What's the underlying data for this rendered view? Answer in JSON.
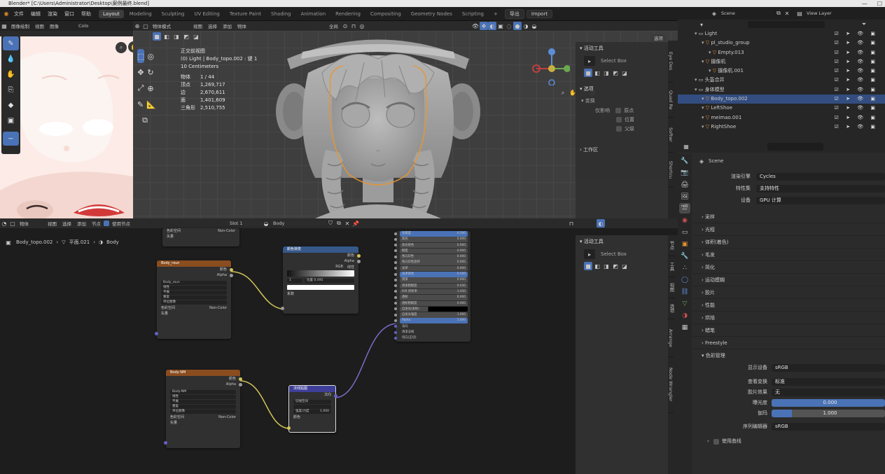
{
  "window": {
    "title": "Blender* [C:\\Users\\Administrator\\Desktop\\案例最终.blend]"
  },
  "menu": [
    "文件",
    "编辑",
    "渲染",
    "窗口",
    "帮助"
  ],
  "workspaces": [
    "Layout",
    "Modeling",
    "Sculpting",
    "UV Editing",
    "Texture Paint",
    "Shading",
    "Animation",
    "Rendering",
    "Compositing",
    "Geometry Nodes",
    "Scripting"
  ],
  "active_workspace": "Layout",
  "topbar_right": {
    "export": "导出",
    "import": "Import",
    "scene": "Scene",
    "view_layer": "View Layer"
  },
  "image_editor": {
    "mode": "图像绘制",
    "view": "视图",
    "image": "图像",
    "color": "Colo"
  },
  "viewport": {
    "mode": "物体模式",
    "menus": [
      "视图",
      "选择",
      "添加",
      "物体"
    ],
    "transform": "全局",
    "options": "选项",
    "info_title": "正交前视图",
    "info_object": "(0) Light | Body_topo.002 : 键 1",
    "info_scale": "10 Centimeters",
    "stats": [
      {
        "label": "物体",
        "value": "1 / 44"
      },
      {
        "label": "顶点",
        "value": "1,269,717"
      },
      {
        "label": "边",
        "value": "2,670,611"
      },
      {
        "label": "面",
        "value": "1,401,609"
      },
      {
        "label": "三角形",
        "value": "2,510,755"
      }
    ],
    "npanel": {
      "active_tool": "活动工具",
      "select_box": "Select Box",
      "options": "选项",
      "transform": "变换",
      "affect_only": "仅影响",
      "origin": "原点",
      "location": "位置",
      "parent": "父级",
      "workspace": "工作区"
    },
    "side_tabs": [
      "Eye Des",
      "Quad Re",
      "Softwr",
      "Shortcu"
    ]
  },
  "node_editor": {
    "menus": [
      "物体",
      "视图",
      "选择",
      "添加",
      "节点"
    ],
    "use_nodes": "使用节点",
    "slot": "Slot 1",
    "material": "Body",
    "breadcrumb": [
      "Body_topo.002",
      "平面.021",
      "Body"
    ],
    "npanel_active_tool": "活动工具",
    "npanel_select_box": "Select Box",
    "side_tabs": [
      "节点",
      "工具",
      "视图",
      "选项",
      "Arrange",
      "Node Wrangler"
    ],
    "nodes": {
      "top_color_space": "色彩空间",
      "top_noncolor": "Non-Color",
      "top_vector": "矢量",
      "tex1_title": "Body_roun",
      "tex1_color": "颜色",
      "tex1_alpha": "Alpha",
      "tex1_image": "Body_roun",
      "tex1_interp": "线性",
      "tex1_proj": "平展",
      "tex1_ext": "重复",
      "tex1_alpha_mode": "单位图像",
      "tex1_cs": "色彩空间",
      "tex1_cs_val": "Non-Color",
      "tex1_vector": "矢量",
      "ramp_title": "颜色渐变",
      "ramp_color": "颜色",
      "ramp_alpha": "Alpha",
      "ramp_mode": "RGB",
      "ramp_interp": "线性",
      "ramp_index": "1",
      "ramp_pos_label": "位置",
      "ramp_pos": "0.495",
      "ramp_fac": "系数",
      "tex2_title": "Body-NM",
      "tex2_color": "颜色",
      "tex2_alpha": "Alpha",
      "tex2_image": "Body-NM",
      "tex2_interp": "线性",
      "tex2_proj": "平展",
      "tex2_ext": "重复",
      "tex2_alpha_mode": "单位图像",
      "tex2_cs": "色彩空间",
      "tex2_cs_val": "Non-Color",
      "tex2_vector": "矢量",
      "nm_title": "法线贴图",
      "nm_normal": "法向",
      "nm_space": "切线空间",
      "nm_strength_label": "强度/力度",
      "nm_strength": "1.000",
      "nm_color": "颜色",
      "bsdf_rows": [
        {
          "label": "金属度",
          "value": "0.500"
        },
        {
          "label": "高光",
          "value": "0.000"
        },
        {
          "label": "高光染色",
          "value": "0.000"
        },
        {
          "label": "糙度",
          "value": "0.000"
        },
        {
          "label": "各向异性",
          "value": "0.000"
        },
        {
          "label": "各向异性旋转",
          "value": "0.000"
        },
        {
          "label": "光泽",
          "value": "0.000"
        },
        {
          "label": "光泽染色",
          "value": "0.500"
        },
        {
          "label": "清漆",
          "value": "0.000"
        },
        {
          "label": "清漆粗糙度",
          "value": "0.030"
        },
        {
          "label": "IOR 折射率",
          "value": "1.450"
        },
        {
          "label": "透射",
          "value": "0.000"
        },
        {
          "label": "透射粗糙度",
          "value": "0.000"
        },
        {
          "label": "自发光(发射)",
          "value": ""
        },
        {
          "label": "自发光强度",
          "value": "1.000"
        },
        {
          "label": "Alpha",
          "value": "1.000"
        },
        {
          "label": "法向",
          "value": ""
        },
        {
          "label": "清漆法线",
          "value": ""
        },
        {
          "label": "切向(正切)",
          "value": ""
        }
      ]
    }
  },
  "outliner": {
    "rows": [
      {
        "label": "Light",
        "indent": 1
      },
      {
        "label": "pl_studio_group",
        "indent": 2
      },
      {
        "label": "Empty.013",
        "indent": 3
      },
      {
        "label": "摄像机",
        "indent": 2
      },
      {
        "label": "摄像机.001",
        "indent": 3
      },
      {
        "label": "头盔合并",
        "indent": 1
      },
      {
        "label": "身体模型",
        "indent": 1
      },
      {
        "label": "Body_topo.002",
        "indent": 2,
        "selected": true
      },
      {
        "label": "LeftShoe",
        "indent": 2
      },
      {
        "label": "meimao.001",
        "indent": 2
      },
      {
        "label": "RightShoe",
        "indent": 2
      }
    ]
  },
  "properties": {
    "scene": "Scene",
    "render_engine_label": "渲染引擎",
    "render_engine": "Cycles",
    "feature_set_label": "特性集",
    "feature_set": "支持特性",
    "device_label": "设备",
    "device": "GPU 计算",
    "sections": [
      "采样",
      "光程",
      "体积(着色)",
      "毛发",
      "简化",
      "运动模糊",
      "胶片",
      "性能",
      "烘焙",
      "蜡笔",
      "Freestyle"
    ],
    "color_mgmt": "色彩管理",
    "display_device_label": "显示设备",
    "display_device": "sRGB",
    "view_transform_label": "查看变换",
    "view_transform": "标准",
    "look_label": "胶片效果",
    "look": "无",
    "exposure_label": "曝光度",
    "exposure": "0.000",
    "gamma_label": "伽玛",
    "gamma": "1.000",
    "sequencer_label": "序列编辑器",
    "sequencer": "sRGB",
    "use_curves": "使用曲线"
  },
  "colors": {
    "accent": "#4a72b6",
    "selection": "#334d80",
    "tex_node_header": "#8a4d1f",
    "ramp_node_header": "#36598a",
    "nm_node_header": "#3f3f9a",
    "link_yellow": "#d2c45a",
    "link_purple": "#7d6bc7",
    "outline_orange": "#e89530"
  }
}
